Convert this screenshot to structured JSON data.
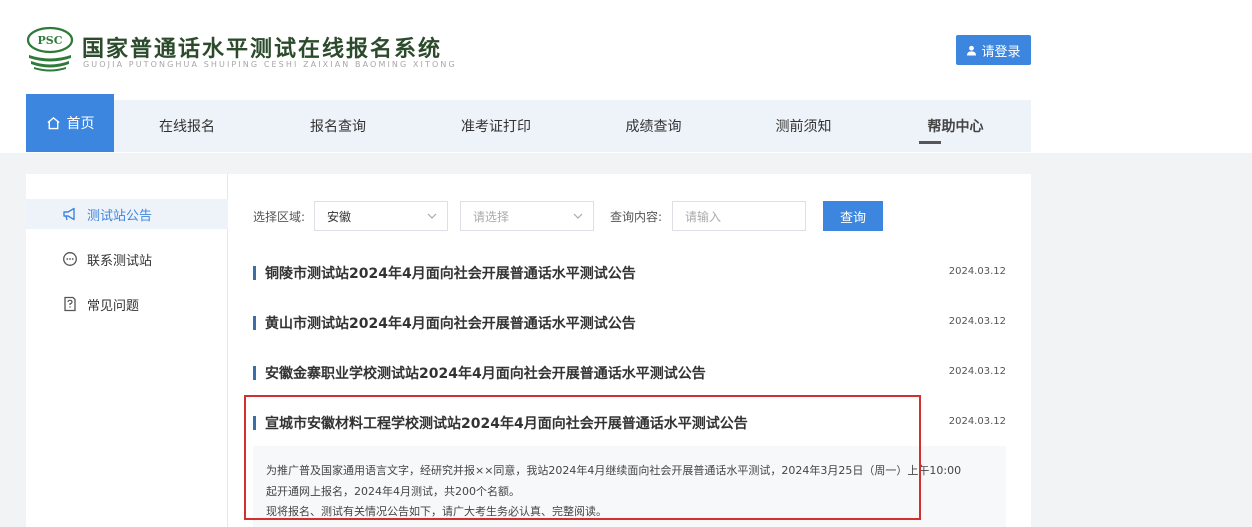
{
  "header": {
    "logo_text": "PSC",
    "title": "国家普通话水平测试在线报名系统",
    "subtitle": "GUOJIA PUTONGHUA SHUIPING CESHI ZAIXIAN BAOMING XITONG",
    "login_label": "请登录"
  },
  "nav": {
    "home": "首页",
    "online_signup": "在线报名",
    "signup_query": "报名查询",
    "ticket_print": "准考证打印",
    "score_query": "成绩查询",
    "notice": "测前须知",
    "help": "帮助中心"
  },
  "sidebar": {
    "items": [
      {
        "label": "测试站公告"
      },
      {
        "label": "联系测试站"
      },
      {
        "label": "常见问题"
      }
    ]
  },
  "filters": {
    "region_label": "选择区域:",
    "region_value": "安徽",
    "sub_placeholder": "请选择",
    "content_label": "查询内容:",
    "content_placeholder": "请输入",
    "query_label": "查询"
  },
  "news": [
    {
      "title": "铜陵市测试站2024年4月面向社会开展普通话水平测试公告",
      "date": "2024.03.12"
    },
    {
      "title": "黄山市测试站2024年4月面向社会开展普通话水平测试公告",
      "date": "2024.03.12"
    },
    {
      "title": "安徽金寨职业学校测试站2024年4月面向社会开展普通话水平测试公告",
      "date": "2024.03.12"
    },
    {
      "title": "宣城市安徽材料工程学校测试站2024年4月面向社会开展普通话水平测试公告",
      "date": "2024.03.12"
    }
  ],
  "expanded": {
    "line1": "为推广普及国家通用语言文字，经研究并报××同意，我站2024年4月继续面向社会开展普通话水平测试，2024年3月25日（周一）上午10:00",
    "line2": "起开通网上报名，2024年4月测试，共200个名额。",
    "line3": "现将报名、测试有关情况公告如下，请广大考生务必认真、完整阅读。"
  },
  "colors": {
    "accent": "#3d86e0",
    "highlight": "#d32f2f"
  }
}
